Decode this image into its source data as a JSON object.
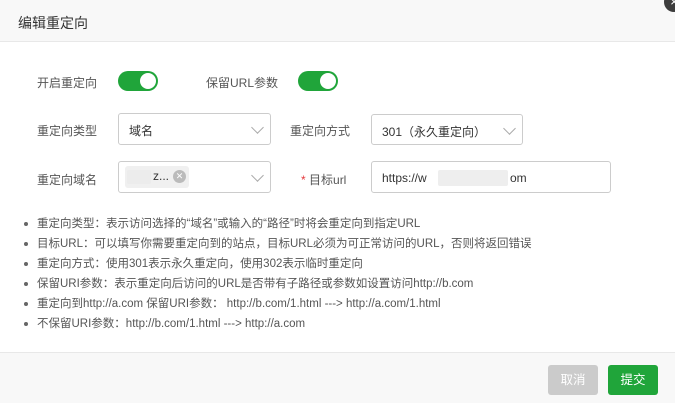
{
  "dialog": {
    "title": "编辑重定向",
    "close_symbol": "×"
  },
  "form": {
    "enable_redirect_label": "开启重定向",
    "enable_redirect_on": true,
    "keep_url_params_label": "保留URL参数",
    "keep_url_params_on": true,
    "redirect_type_label": "重定向类型",
    "redirect_type_value": "域名",
    "redirect_method_label": "重定向方式",
    "redirect_method_value": "301（永久重定向）",
    "redirect_domain_label": "重定向域名",
    "redirect_domain_tag": "z...",
    "target_url_required": "*",
    "target_url_label": "目标url",
    "target_url_prefix": "https://w",
    "target_url_suffix": "om"
  },
  "notes": [
    "重定向类型：表示访问选择的“域名”或输入的“路径”时将会重定向到指定URL",
    "目标URL：可以填写你需要重定向到的站点，目标URL必须为可正常访问的URL，否则将返回错误",
    "重定向方式：使用301表示永久重定向，使用302表示临时重定向",
    "保留URI参数：表示重定向后访问的URL是否带有子路径或参数如设置访问http://b.com",
    "重定向到http://a.com 保留URI参数： http://b.com/1.html ---> http://a.com/1.html",
    "不保留URI参数：http://b.com/1.html ---> http://a.com"
  ],
  "footer": {
    "cancel_label": "取消",
    "submit_label": "提交"
  },
  "colors": {
    "accent_green": "#20a53a",
    "disabled_gray": "#cbcbcb"
  }
}
